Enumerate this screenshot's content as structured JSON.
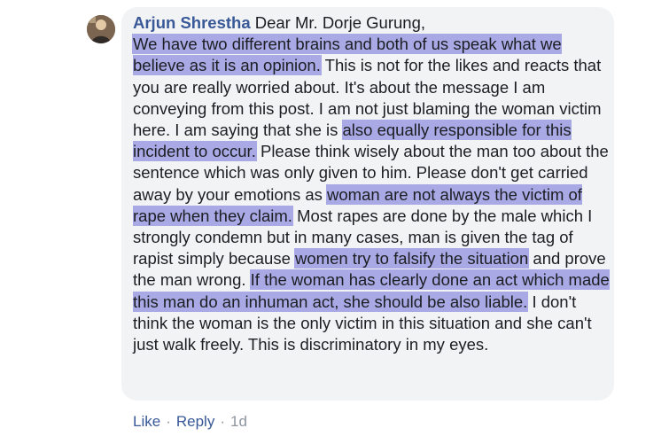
{
  "comment": {
    "author": "Arjun Shrestha",
    "segments": {
      "s0": " Dear Mr. Dorje Gurung,",
      "h1": "We have two different brains and both of us speak what we believe as it is an opinion.",
      "s1": " This is not for the likes and reacts that you are really worried about. It's about the message I am conveying from this post. I am not just blaming the woman victim here. I am saying that she is ",
      "h2": "also equally responsible for this incident to occur.",
      "s2": " Please think wisely about the man too about the sentence which was only given to him. Please don't get carried away by your emotions as ",
      "h3": "woman are not always the victim of rape when they claim.",
      "s3": " Most rapes are done by the male which I strongly condemn but in many cases, man is given the tag of rapist simply because ",
      "h4": "women try to falsify the situation",
      "s4": " and prove the man wrong. ",
      "h5": "If the woman has clearly done an act which made this man do an inhuman act, she should be also liable.",
      "s5": " I don't think the woman is the only victim in this situation and she can't just walk freely. This is discriminatory in my eyes."
    },
    "highlight_color": "#a9a9e6",
    "author_color": "#385898"
  },
  "actions": {
    "like": "Like",
    "separator": "·",
    "reply": "Reply",
    "time": "1d"
  },
  "icons": {
    "avatar": "user-avatar-photo"
  }
}
